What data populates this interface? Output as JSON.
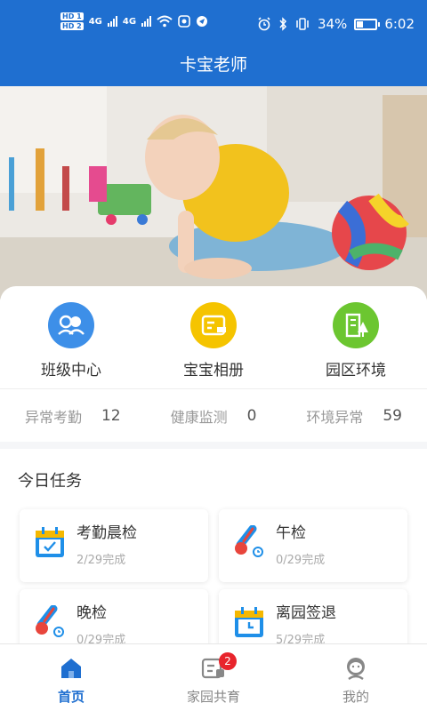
{
  "status_bar": {
    "hd1": "HD 1",
    "hd2": "HD 2",
    "net1": "4G",
    "net2": "4G",
    "battery": "34%",
    "battery_level": 0.34,
    "time": "6:02"
  },
  "header": {
    "title": "卡宝老师"
  },
  "quick_entries": [
    {
      "label": "班级中心",
      "icon": "class-people-icon",
      "color": "#3d8fe8"
    },
    {
      "label": "宝宝相册",
      "icon": "album-icon",
      "color": "#f5c400"
    },
    {
      "label": "园区环境",
      "icon": "building-tree-icon",
      "color": "#6cc630"
    }
  ],
  "stats": [
    {
      "label": "异常考勤",
      "value": "12"
    },
    {
      "label": "健康监测",
      "value": "0"
    },
    {
      "label": "环境异常",
      "value": "59"
    }
  ],
  "tasks": {
    "heading": "今日任务",
    "items": [
      {
        "name": "考勤晨检",
        "progress": "2/29完成",
        "icon": "calendar-check-icon"
      },
      {
        "name": "午检",
        "progress": "0/29完成",
        "icon": "thermometer-icon"
      },
      {
        "name": "晚检",
        "progress": "0/29完成",
        "icon": "thermometer-icon"
      },
      {
        "name": "离园签退",
        "progress": "5/29完成",
        "icon": "calendar-clock-icon"
      }
    ]
  },
  "tabbar": [
    {
      "label": "首页",
      "icon": "home-icon",
      "active": true
    },
    {
      "label": "家园共育",
      "icon": "chat-card-icon",
      "badge": "2",
      "active": false
    },
    {
      "label": "我的",
      "icon": "profile-icon",
      "active": false
    }
  ],
  "colors": {
    "primary": "#1f6fd0",
    "badge": "#e8242c"
  }
}
